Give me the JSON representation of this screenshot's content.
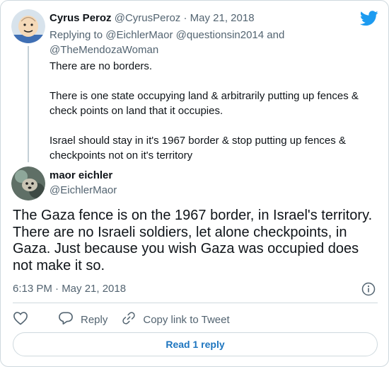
{
  "reply_tweet": {
    "author_name": "Cyrus Peroz",
    "author_handle": "@CyrusPeroz",
    "separator": " · ",
    "date": "May 21, 2018",
    "replying_prefix": "Replying to",
    "replying_to": "@EichlerMaor @questionsin2014 and @TheMendozaWoman",
    "paragraphs": [
      "There are no borders.",
      "There is one state occupying land & arbitrarily putting up fences & check points on land that it occupies.",
      "Israel should stay in it's 1967 border & stop putting up fences & checkpoints not on it's territory"
    ]
  },
  "main_tweet": {
    "author_name": "maor eichler",
    "author_handle": "@EichlerMaor",
    "text": "The Gaza fence is on the 1967 border, in Israel's territory. There are no Israeli soldiers, let alone checkpoints, in Gaza. Just because you wish Gaza was occupied does not make it so.",
    "timestamp": "6:13 PM · May 21, 2018"
  },
  "actions": {
    "reply_label": "Reply",
    "copy_link_label": "Copy link to Tweet"
  },
  "read_replies_label": "Read 1 reply",
  "icons": {
    "brand": "twitter-bird-icon",
    "info": "info-icon",
    "like": "heart-icon",
    "reply": "reply-bubble-icon",
    "link": "link-icon"
  },
  "colors": {
    "brand_blue": "#1d9bf0",
    "link_blue": "#1d75bf",
    "muted": "#536471",
    "text": "#0f1419",
    "border": "#cfd9de"
  }
}
